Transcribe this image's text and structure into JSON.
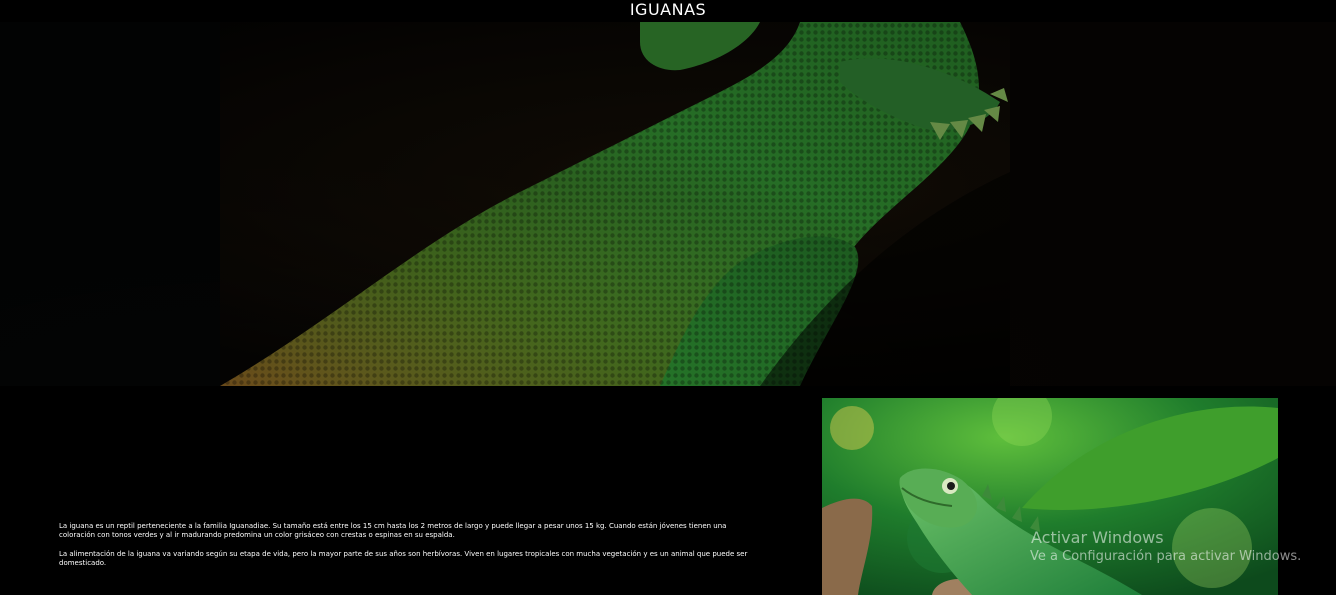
{
  "header": {
    "title": "IGUANAS"
  },
  "hero": {
    "image": "iguana-dark-closeup-photo"
  },
  "content": {
    "paragraphs": [
      "La iguana es un reptil perteneciente a la familia Iguanadiae. Su tamaño está entre los 15 cm hasta los 2 metros de largo y puede llegar a pesar unos 15 kg. Cuando están jóvenes tienen una coloración con tonos verdes y al ir madurando predomina un color grisáceo con crestas o espinas en su espalda.",
      "La alimentación de la iguana va variando según su etapa de vida, pero la mayor parte de sus años son herbívoras. Viven en lugares tropicales con mucha vegetación y es un animal que puede ser domesticado."
    ],
    "side_image": "green-iguana-on-branch-photo"
  },
  "watermark": {
    "title": "Activar Windows",
    "subtitle": "Ve a Configuración para activar Windows."
  },
  "colors": {
    "background": "#000000",
    "text": "#ffffff",
    "lizard_green": "#3fa83a"
  }
}
